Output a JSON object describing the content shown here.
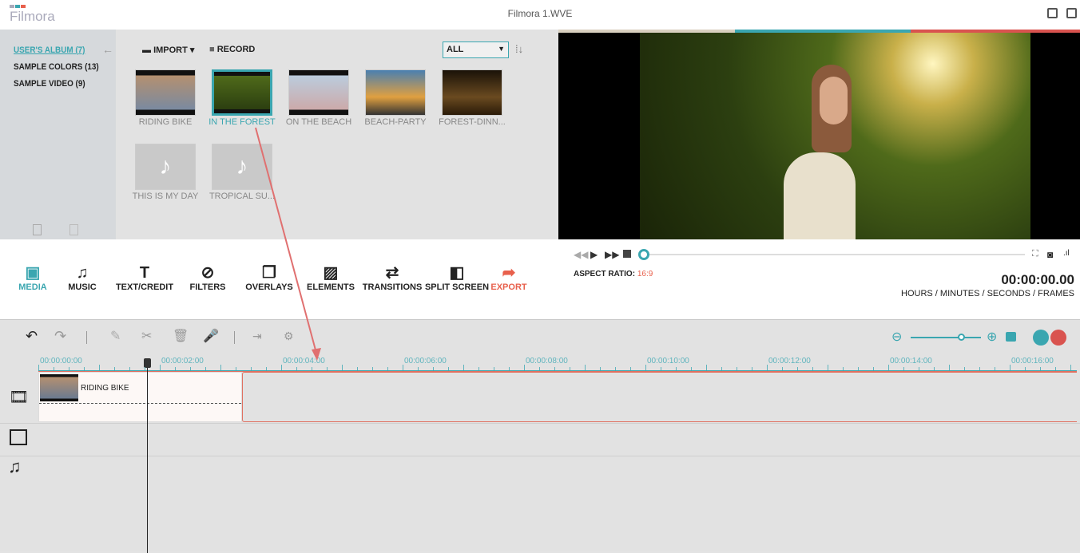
{
  "app": {
    "logo": "Filmora",
    "title": "Filmora 1.WVE"
  },
  "sidebar": {
    "albums": [
      {
        "label": "USER'S ALBUM (7)",
        "active": true
      },
      {
        "label": "SAMPLE COLORS (13)"
      },
      {
        "label": "SAMPLE VIDEO (9)"
      }
    ]
  },
  "media": {
    "import_label": "IMPORT",
    "record_label": "RECORD",
    "filter": "ALL",
    "items": [
      {
        "label": "RIDING BIKE",
        "type": "video"
      },
      {
        "label": "IN THE FOREST",
        "type": "video",
        "selected": true
      },
      {
        "label": "ON THE BEACH",
        "type": "video"
      },
      {
        "label": "BEACH-PARTY",
        "type": "video"
      },
      {
        "label": "FOREST-DINN...",
        "type": "video"
      },
      {
        "label": "THIS IS MY DAY",
        "type": "audio"
      },
      {
        "label": "TROPICAL SU...",
        "type": "audio"
      }
    ]
  },
  "tools": [
    {
      "label": "MEDIA",
      "icon": "media-icon",
      "active": true
    },
    {
      "label": "MUSIC",
      "icon": "music-icon"
    },
    {
      "label": "TEXT/CREDIT",
      "icon": "text-icon"
    },
    {
      "label": "FILTERS",
      "icon": "filters-icon"
    },
    {
      "label": "OVERLAYS",
      "icon": "overlays-icon"
    },
    {
      "label": "ELEMENTS",
      "icon": "elements-icon"
    },
    {
      "label": "TRANSITIONS",
      "icon": "transitions-icon"
    },
    {
      "label": "SPLIT SCREEN",
      "icon": "split-screen-icon"
    },
    {
      "label": "EXPORT",
      "icon": "export-icon"
    }
  ],
  "player": {
    "aspect_label": "ASPECT RATIO:",
    "aspect_value": "16:9",
    "timecode": "00:00:00.00",
    "timecode_units": "HOURS / MINUTES / SECONDS / FRAMES",
    "progress": 0
  },
  "timeline": {
    "ticks": [
      "00:00:00:00",
      "00:00:02:00",
      "00:00:04:00",
      "00:00:06:00",
      "00:00:08:00",
      "00:00:10:00",
      "00:00:12:00",
      "00:00:14:00",
      "00:00:16:00"
    ],
    "clip_label": "RIDING BIKE",
    "zoom_level": 0.75
  },
  "colors": {
    "accent": "#3aa6b0",
    "export": "#e8604c",
    "red": "#d9534f"
  }
}
